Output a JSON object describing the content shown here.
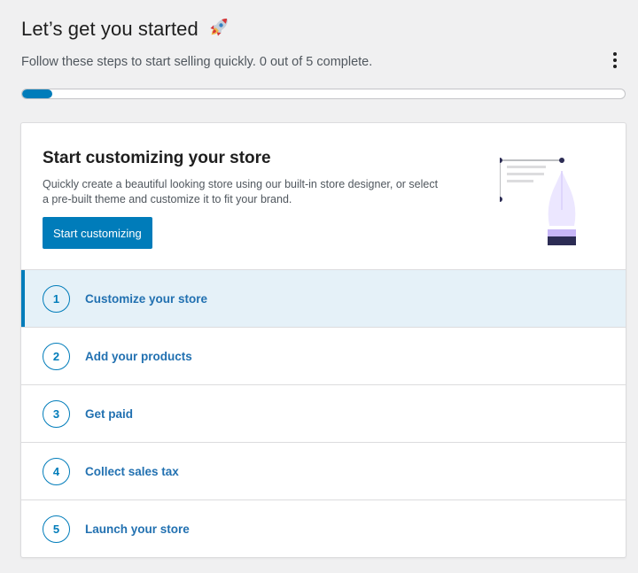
{
  "header": {
    "title": "Let’s get you started",
    "title_icon": "rocket-icon",
    "subtitle": "Follow these steps to start selling quickly. 0 out of 5 complete.",
    "progress_percent": 5,
    "menu_icon": "more-vertical-icon"
  },
  "hero": {
    "title": "Start customizing your store",
    "description": "Quickly create a beautiful looking store using our built-in store designer, or select a pre-built theme and customize it to fit your brand.",
    "button_label": "Start customizing",
    "illustration_icon": "pen-tool-illustration"
  },
  "tasks": [
    {
      "number": "1",
      "label": "Customize your store",
      "active": true
    },
    {
      "number": "2",
      "label": "Add your products",
      "active": false
    },
    {
      "number": "3",
      "label": "Get paid",
      "active": false
    },
    {
      "number": "4",
      "label": "Collect sales tax",
      "active": false
    },
    {
      "number": "5",
      "label": "Launch your store",
      "active": false
    }
  ],
  "colors": {
    "accent": "#007cba",
    "link": "#2271b1",
    "active_row": "#e5f1f8",
    "background": "#f0f0f1"
  }
}
